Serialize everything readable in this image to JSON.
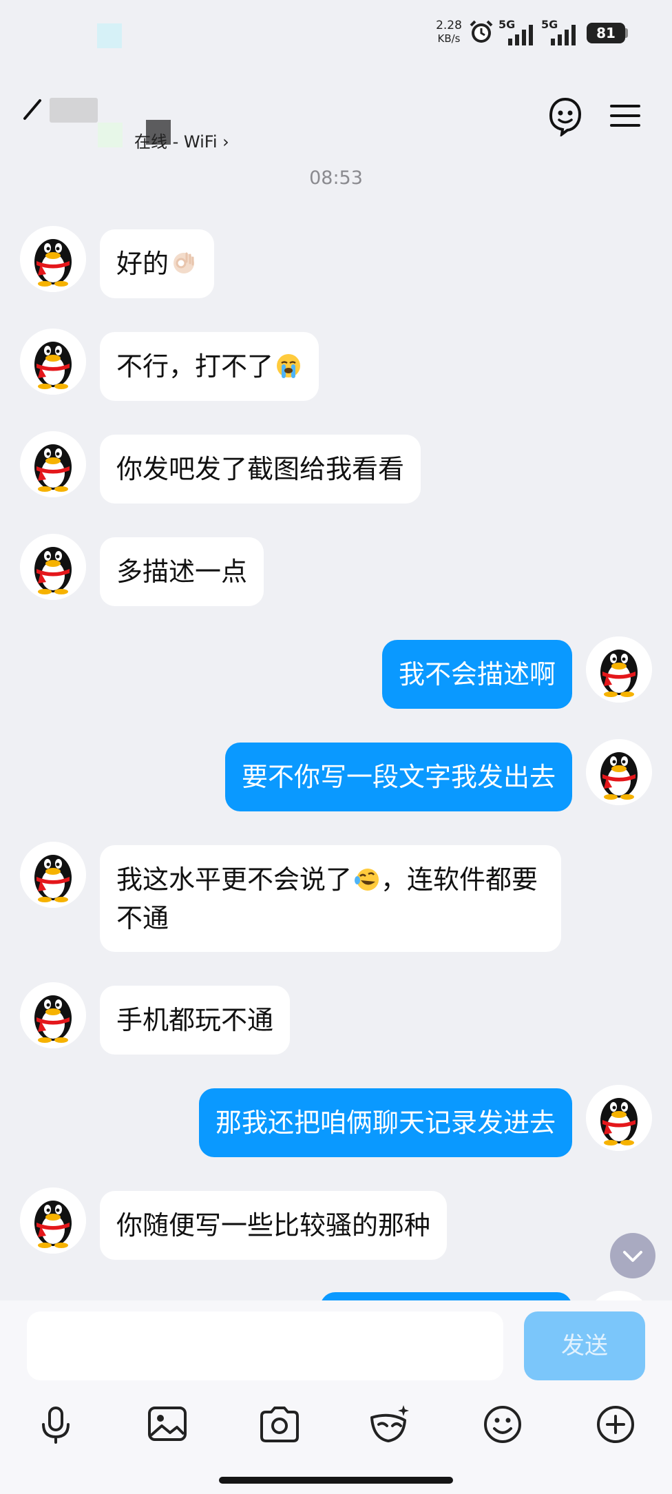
{
  "status_bar": {
    "speed_value": "2.28",
    "speed_unit": "KB/s",
    "sig1": "5G",
    "sig2": "5G",
    "battery": "81"
  },
  "header": {
    "status": "在线 - WiFi ›"
  },
  "timestamp": "08:53",
  "messages": [
    {
      "dir": "in",
      "text": "好的",
      "emoji": "ok-hand-emoji"
    },
    {
      "dir": "in",
      "text": "不行，打不了",
      "emoji": "crying-emoji"
    },
    {
      "dir": "in",
      "text": "你发吧发了截图给我看看"
    },
    {
      "dir": "in",
      "text": "多描述一点"
    },
    {
      "dir": "out",
      "text": "我不会描述啊"
    },
    {
      "dir": "out",
      "text": "要不你写一段文字我发出去"
    },
    {
      "dir": "in",
      "text_a": "我这水平更不会说了",
      "emoji": "laugh-cry-emoji",
      "text_b": "，连软件都要不通"
    },
    {
      "dir": "in",
      "text": "手机都玩不通"
    },
    {
      "dir": "out",
      "text": "那我还把咱俩聊天记录发进去"
    },
    {
      "dir": "in",
      "text": "你随便写一些比较骚的那种"
    }
  ],
  "composer": {
    "placeholder": "",
    "send_label": "发送"
  },
  "toolbar_icons": [
    "microphone-icon",
    "image-icon",
    "camera-icon",
    "mask-icon",
    "emoji-icon",
    "plus-icon"
  ],
  "colors": {
    "outgoing_bubble": "#0a99ff",
    "incoming_bubble": "#ffffff",
    "background": "#eff0f4",
    "send_button": "#7bc6fa"
  }
}
